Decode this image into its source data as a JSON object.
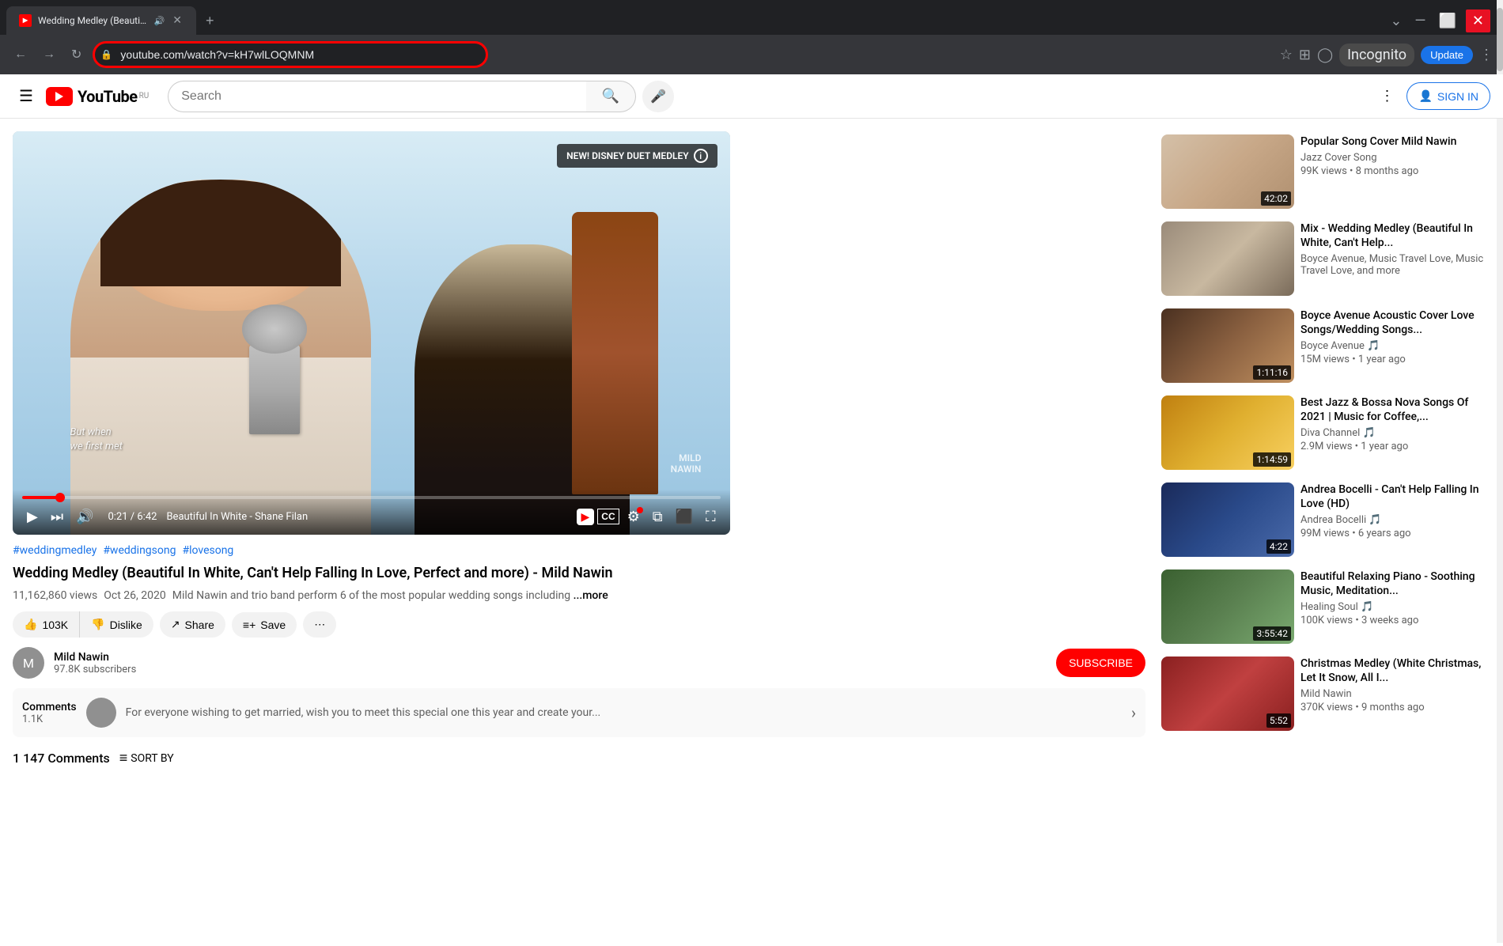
{
  "browser": {
    "tab": {
      "title": "Wedding Medley (Beautiful ...",
      "favicon_bg": "#ff0000",
      "audio_icon": "🔊",
      "close_icon": "✕"
    },
    "new_tab_icon": "+",
    "window_controls": {
      "expand_down": "⌄",
      "minimize": "—",
      "maximize": "⬜",
      "close": "✕"
    },
    "nav": {
      "back": "←",
      "forward": "→",
      "refresh": "↻"
    },
    "address": "youtube.com/watch?v=kH7wlLOQMNM",
    "lock_icon": "🔒",
    "toolbar_icons": {
      "bookmark_star": "☆",
      "customize": "⊞",
      "profile_circle": "◯",
      "more": "⋮"
    },
    "incognito": "Incognito",
    "update": "Update",
    "update_more": "⋮"
  },
  "youtube": {
    "menu_icon": "☰",
    "logo_text": "YouTube",
    "logo_locale": "RU",
    "search_placeholder": "Search",
    "search_icon": "🔍",
    "mic_icon": "🎤",
    "header_icons": {
      "more_dots": "⋮"
    },
    "sign_in_icon": "👤",
    "sign_in_label": "SIGN IN"
  },
  "video": {
    "disney_badge": "NEW! DISNEY DUET MEDLEY",
    "info_icon": "i",
    "overlay_text_line1": "But when",
    "overlay_text_line2": "we first met",
    "watermark_line1": "MILD",
    "watermark_line2": "NAWIN",
    "progress_percent": 5.5,
    "current_time": "0:21",
    "total_time": "6:42",
    "chapter_name": "Beautiful In White - Shane Filan",
    "controls": {
      "play": "▶",
      "next": "⏭",
      "volume": "🔊",
      "cinema_mode": "⬛",
      "subtitles": "CC",
      "settings": "⚙",
      "miniplayer": "⧉",
      "fullscreen": "⛶",
      "yt_logo": "▶"
    }
  },
  "video_info": {
    "hashtags": [
      "#weddingmedley",
      "#weddingsong",
      "#lovesong"
    ],
    "title": "Wedding Medley (Beautiful In White, Can't Help Falling In Love, Perfect and more) - Mild Nawin",
    "views": "11,162,860 views",
    "date": "Oct 26, 2020",
    "description": "Mild Nawin and trio band perform 6 of the most popular wedding songs including",
    "more_label": "...more",
    "likes": "103K",
    "dislike_label": "Dislike",
    "share_icon": "↗",
    "share_label": "Share",
    "save_icon": "≡+",
    "save_label": "Save",
    "more_icon": "⋯",
    "channel": {
      "name": "Mild Nawin",
      "subscribers": "97.8K subscribers",
      "avatar_text": "M"
    },
    "subscribe_label": "SUBSCRIBE"
  },
  "comments": {
    "label": "Comments",
    "count": "1.1K",
    "preview_text": "For everyone wishing to get married, wish you to meet this special one this year and create your...",
    "sort_label": "SORT BY"
  },
  "comments_section": {
    "count_label": "1 147 Comments",
    "sort_label": "SORT BY"
  },
  "sidebar": {
    "videos": [
      {
        "id": 1,
        "title": "Popular Song Cover Mild Nawin",
        "channel": "Jazz Cover Song",
        "stats": "99K views • 8 months ago",
        "duration": "42:02",
        "thumb_colors": [
          "#d4b8a8",
          "#e8c8b8",
          "#c09080"
        ]
      },
      {
        "id": 2,
        "title": "Mix - Wedding Medley (Beautiful In White, Can't Help...",
        "channel": "Boyce Avenue, Music Travel Love, Music Travel Love, and more",
        "stats": "",
        "duration": "",
        "thumb_colors": [
          "#8B7355",
          "#A0896B",
          "#6B5540"
        ]
      },
      {
        "id": 3,
        "title": "Boyce Avenue Acoustic Cover Love Songs/Wedding Songs...",
        "channel": "Boyce Avenue 🎵",
        "stats": "15M views • 1 year ago",
        "duration": "1:11:16",
        "thumb_colors": [
          "#3d2b1f",
          "#7a5535",
          "#b07040"
        ]
      },
      {
        "id": 4,
        "title": "Best Jazz & Bossa Nova Songs Of 2021 | Music for Coffee,...",
        "channel": "Diva Channel 🎵",
        "stats": "2.9M views • 1 year ago",
        "duration": "1:14:59",
        "thumb_colors": [
          "#d4a020",
          "#e8c040",
          "#f0d060"
        ]
      },
      {
        "id": 5,
        "title": "Andrea Bocelli - Can't Help Falling In Love (HD)",
        "channel": "Andrea Bocelli 🎵",
        "stats": "99M views • 6 years ago",
        "duration": "4:22",
        "thumb_colors": [
          "#1a3a6a",
          "#2a4a8a",
          "#3a5aaa"
        ]
      },
      {
        "id": 6,
        "title": "Beautiful Relaxing Piano - Soothing Music, Meditation...",
        "channel": "Healing Soul 🎵",
        "stats": "100K views • 3 weeks ago",
        "duration": "3:55:42",
        "thumb_colors": [
          "#4a7040",
          "#6a9055",
          "#8ab070"
        ]
      },
      {
        "id": 7,
        "title": "Christmas Medley (White Christmas, Let It Snow, All I...",
        "channel": "Mild Nawin",
        "stats": "370K views • 9 months ago",
        "duration": "5:52",
        "thumb_colors": [
          "#c44040",
          "#e05050",
          "#8B4040"
        ]
      }
    ]
  }
}
